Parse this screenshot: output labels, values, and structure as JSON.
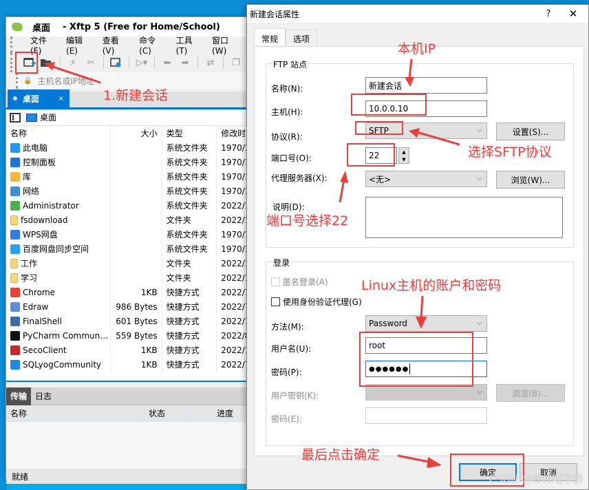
{
  "xftp": {
    "title_location": "桌面",
    "title_app": "- Xftp 5 (Free for Home/School)",
    "menu": [
      "文件(F)",
      "编辑(E)",
      "查看(V)",
      "命令(C)",
      "工具(T)",
      "窗口(W)"
    ],
    "address_placeholder": "主机名或IP地址",
    "tab": {
      "label": "桌面",
      "close": "×"
    },
    "path": "桌面",
    "columns": {
      "name": "名称",
      "size": "大小",
      "type": "类型",
      "date": "修改时"
    },
    "files": [
      {
        "name": "此电脑",
        "size": "",
        "type": "系统文件夹",
        "date": "1970/1",
        "icon": "computer-icon",
        "color": "#2196f3"
      },
      {
        "name": "控制面板",
        "size": "",
        "type": "系统文件夹",
        "date": "1970/1",
        "icon": "control-panel-icon",
        "color": "#1976d2"
      },
      {
        "name": "库",
        "size": "",
        "type": "系统文件夹",
        "date": "1970/1",
        "icon": "library-icon",
        "color": "#f6b73c"
      },
      {
        "name": "网络",
        "size": "",
        "type": "系统文件夹",
        "date": "1970/1",
        "icon": "network-icon",
        "color": "#3d8fd6"
      },
      {
        "name": "Administrator",
        "size": "",
        "type": "系统文件夹",
        "date": "2022/1",
        "icon": "user-icon",
        "color": "#4caf50"
      },
      {
        "name": "fsdownload",
        "size": "",
        "type": "文件夹",
        "date": "2022/1",
        "icon": "folder-icon",
        "color": "#f7d774"
      },
      {
        "name": "WPS网盘",
        "size": "",
        "type": "系统文件夹",
        "date": "1970/1",
        "icon": "cloud-icon",
        "color": "#2f7fe0"
      },
      {
        "name": "百度网盘同步空间",
        "size": "",
        "type": "系统文件夹",
        "date": "1970/1",
        "icon": "baidu-icon",
        "color": "#2a9df4"
      },
      {
        "name": "工作",
        "size": "",
        "type": "文件夹",
        "date": "2022/1",
        "icon": "folder-icon",
        "color": "#f7d774"
      },
      {
        "name": "学习",
        "size": "",
        "type": "文件夹",
        "date": "2022/1",
        "icon": "folder-icon",
        "color": "#f7d774"
      },
      {
        "name": "Chrome",
        "size": "1KB",
        "type": "快捷方式",
        "date": "2022/1",
        "icon": "chrome-icon",
        "color": "#e94235"
      },
      {
        "name": "Edraw",
        "size": "986 Bytes",
        "type": "快捷方式",
        "date": "2022/7",
        "icon": "edraw-icon",
        "color": "#5c8fd6"
      },
      {
        "name": "FinalShell",
        "size": "601 Bytes",
        "type": "快捷方式",
        "date": "2022/1",
        "icon": "finalshell-icon",
        "color": "#3a6ea5"
      },
      {
        "name": "PyCharm Communit...",
        "size": "559 Bytes",
        "type": "快捷方式",
        "date": "2022/8",
        "icon": "pycharm-icon",
        "color": "#111111"
      },
      {
        "name": "SecoClient",
        "size": "1KB",
        "type": "快捷方式",
        "date": "2022/1",
        "icon": "secoclient-icon",
        "color": "#c62828"
      },
      {
        "name": "SQLyogCommunity",
        "size": "1KB",
        "type": "快捷方式",
        "date": "2022/7",
        "icon": "sqlyog-icon",
        "color": "#1e88e5"
      }
    ],
    "transfer_tabs": [
      "传输",
      "日志"
    ],
    "transfer_columns": {
      "name": "名称",
      "status": "状态",
      "progress": "进度"
    },
    "status": "就绪"
  },
  "dialog": {
    "title": "新建会话属性",
    "help": "?",
    "close": "✕",
    "tabs": [
      "常规",
      "选项"
    ],
    "ftp_group": "FTP 站点",
    "name_label": "名称(N):",
    "name_value": "新建会话",
    "host_label": "主机(H):",
    "host_value": "10.0.0.10",
    "protocol_label": "协议(R):",
    "protocol_value": "SFTP",
    "settings_button": "设置(S)...",
    "port_label": "端口号(O):",
    "port_value": "22",
    "proxy_label": "代理服务器(X):",
    "proxy_value": "<无>",
    "browse_proxy_button": "浏览(W)...",
    "desc_label": "说明(D):",
    "desc_value": "",
    "login_group": "登录",
    "anonymous_label": "匿名登录(A)",
    "auth_agent_label": "使用身份验证代理(G)",
    "method_label": "方法(M):",
    "method_value": "Password",
    "user_label": "用户名(U):",
    "user_value": "root",
    "password_label": "密码(P):",
    "password_value": "●●●●●●",
    "userkey_label": "用户密钥(K):",
    "browse_key_button": "浏览(B)...",
    "passphrase_label": "密码(E):",
    "ok_button": "确定",
    "cancel_button": "取消"
  },
  "annotations": {
    "new_session": "1.新建会话",
    "local_ip": "本机IP",
    "select_sftp": "选择SFTP协议",
    "port_22": "端口号选择22",
    "linux_account": "Linux主机的账户和密码",
    "click_ok": "最后点击确定",
    "color": "#f03c3c"
  },
  "watermark": "CSDN @棒棒吃不胖"
}
